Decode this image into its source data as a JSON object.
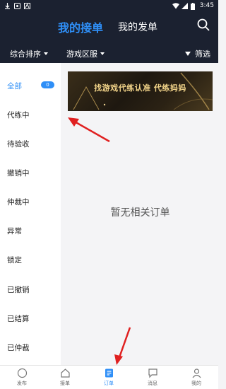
{
  "status_bar": {
    "time": "3:45"
  },
  "header": {
    "tab_active": "我的接单",
    "tab_other": "我的发单"
  },
  "filters": {
    "sort_label": "综合排序",
    "region_label": "游戏区服",
    "filter_label": "筛选"
  },
  "sidebar": {
    "items": [
      {
        "label": "全部",
        "badge": "0",
        "active": true
      },
      {
        "label": "代练中"
      },
      {
        "label": "待验收"
      },
      {
        "label": "撤销中"
      },
      {
        "label": "仲裁中"
      },
      {
        "label": "异常"
      },
      {
        "label": "锁定"
      },
      {
        "label": "已撤销"
      },
      {
        "label": "已结算"
      },
      {
        "label": "已仲裁"
      }
    ]
  },
  "banner": {
    "text": "找游戏代练认准 代练妈妈"
  },
  "main": {
    "empty_text": "暂无相关订单"
  },
  "bottom_nav": {
    "items": [
      {
        "label": "发布"
      },
      {
        "label": "接单"
      },
      {
        "label": "订单",
        "active": true
      },
      {
        "label": "消息"
      },
      {
        "label": "我的"
      }
    ]
  },
  "colors": {
    "accent": "#2f8ff7",
    "header_bg": "#1b2130",
    "annotation": "#e02020"
  }
}
